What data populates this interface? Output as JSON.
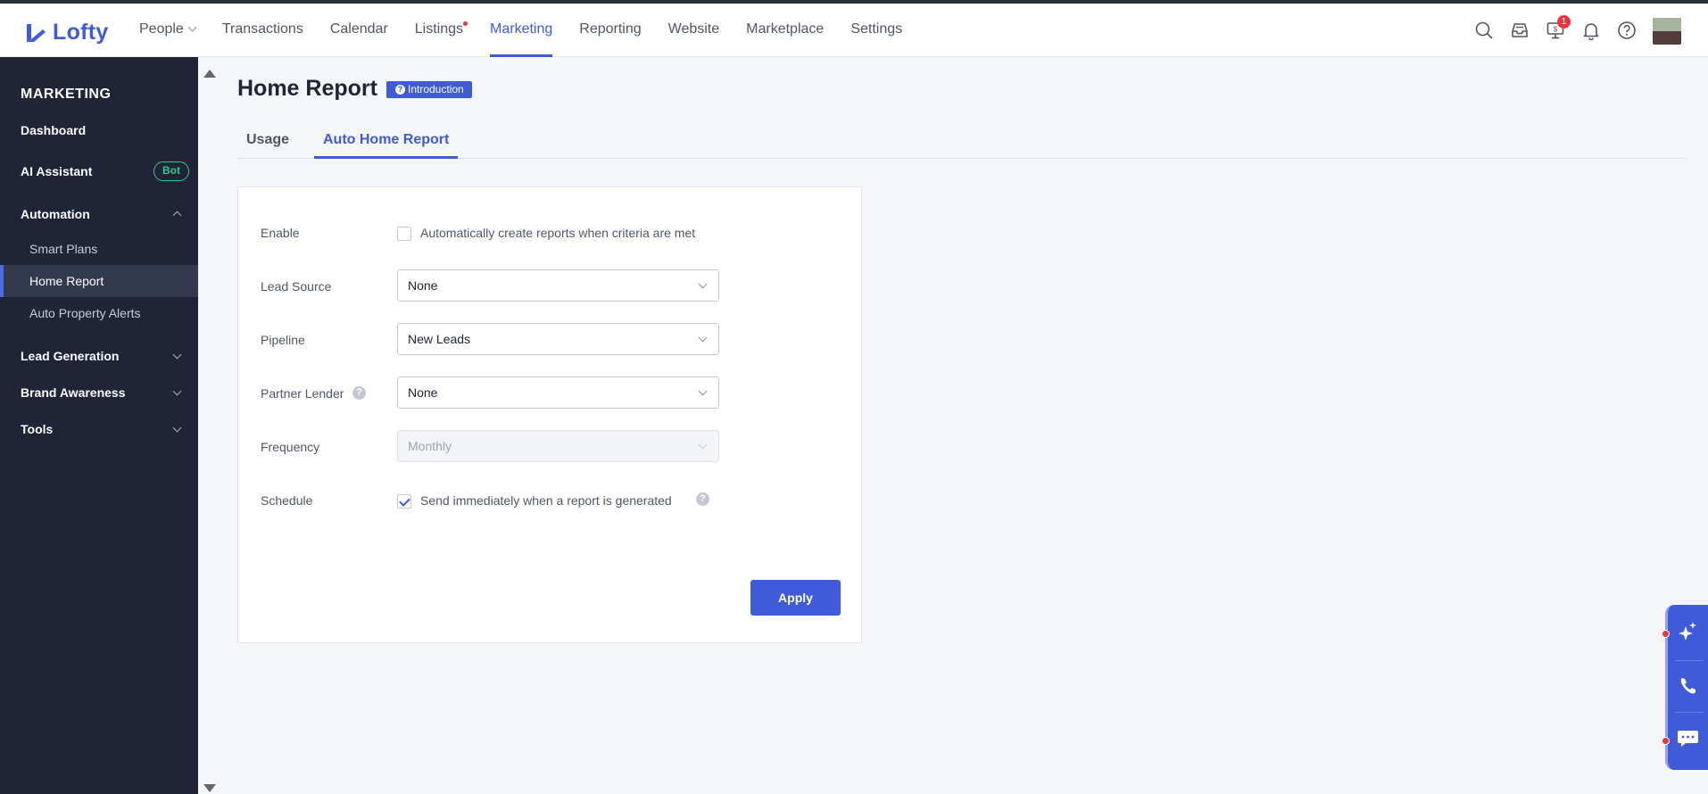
{
  "app": {
    "brand": "Lofty",
    "brand_color": "#3f5bd9"
  },
  "topnav": {
    "items": [
      {
        "label": "People",
        "has_dropdown": true
      },
      {
        "label": "Transactions"
      },
      {
        "label": "Calendar"
      },
      {
        "label": "Listings",
        "has_dot": true
      },
      {
        "label": "Marketing",
        "active": true
      },
      {
        "label": "Reporting"
      },
      {
        "label": "Website"
      },
      {
        "label": "Marketplace"
      },
      {
        "label": "Settings"
      }
    ],
    "icons": [
      "search-icon",
      "inbox-icon",
      "billing-icon",
      "bell-icon",
      "help-icon"
    ],
    "billing_badge": "1"
  },
  "sidebar": {
    "title": "MARKETING",
    "dashboard": "Dashboard",
    "ai_assistant": "AI Assistant",
    "ai_badge": "Bot",
    "automation": "Automation",
    "automation_children": [
      "Smart Plans",
      "Home Report",
      "Auto Property Alerts"
    ],
    "selected": "Home Report",
    "lead_generation": "Lead Generation",
    "brand_awareness": "Brand Awareness",
    "tools": "Tools"
  },
  "page": {
    "title": "Home Report",
    "intro_badge": "Introduction",
    "tabs": [
      "Usage",
      "Auto Home Report"
    ],
    "active_tab": "Auto Home Report"
  },
  "form": {
    "enable": {
      "label": "Enable",
      "checkbox_text": "Automatically create reports when criteria are met",
      "checked": false
    },
    "lead_source": {
      "label": "Lead Source",
      "value": "None"
    },
    "pipeline": {
      "label": "Pipeline",
      "value": "New Leads"
    },
    "partner_lender": {
      "label": "Partner Lender",
      "value": "None"
    },
    "frequency": {
      "label": "Frequency",
      "value": "Monthly",
      "disabled": true
    },
    "schedule": {
      "label": "Schedule",
      "checkbox_text": "Send immediately when a report is generated",
      "checked": true
    },
    "apply": "Apply"
  },
  "rail": {
    "icons": [
      "sparkle-ai-icon",
      "phone-icon",
      "chat-icon"
    ]
  }
}
